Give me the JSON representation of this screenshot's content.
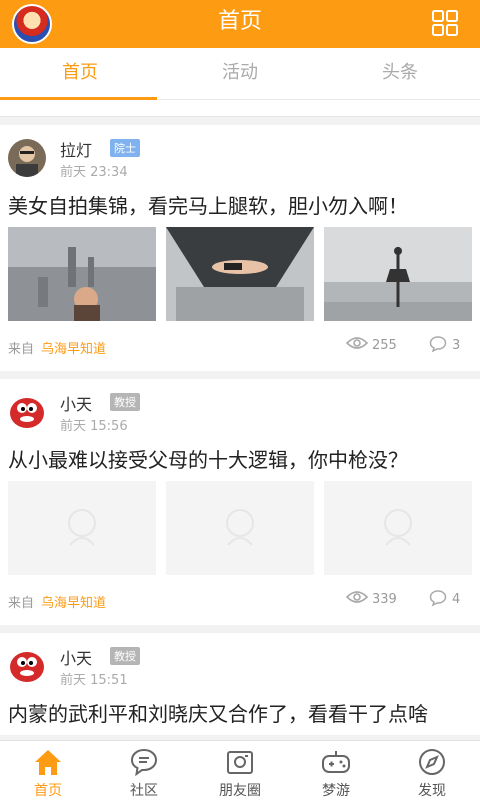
{
  "header": {
    "title": "首页",
    "avatar_icon": "mario-avatar-icon",
    "menu_icon": "grid-icon",
    "brand_color": "#fd9b13"
  },
  "tabs": [
    {
      "label": "首页",
      "active": true
    },
    {
      "label": "活动",
      "active": false
    },
    {
      "label": "头条",
      "active": false
    }
  ],
  "posts": [
    {
      "user": "拉灯",
      "badge": "院士",
      "badge_color": "#7fb2ee",
      "time": "前天 23:34",
      "text": "美女自拍集锦，看完马上腿软，胆小勿入啊！",
      "images": [
        "rooftop-selfie-photo",
        "ledge-pose-photo",
        "ballet-skyline-photo"
      ],
      "source_prefix": "来自",
      "source": "乌海早知道",
      "views": "255",
      "comments": "3"
    },
    {
      "user": "小天",
      "badge": "教授",
      "badge_color": "#b5b5b5",
      "time": "前天 15:56",
      "text": "从小最难以接受父母的十大逻辑，你中枪没？",
      "images": [
        "placeholder-image",
        "placeholder-image",
        "placeholder-image"
      ],
      "source_prefix": "来自",
      "source": "乌海早知道",
      "views": "339",
      "comments": "4"
    },
    {
      "user": "小天",
      "badge": "教授",
      "badge_color": "#b5b5b5",
      "time": "前天 15:51",
      "text": "内蒙的武利平和刘晓庆又合作了，看看干了点啥"
    }
  ],
  "bottom_nav": [
    {
      "label": "首页",
      "icon": "home-icon",
      "active": true
    },
    {
      "label": "社区",
      "icon": "chat-bubble-icon",
      "active": false
    },
    {
      "label": "朋友圈",
      "icon": "camera-icon",
      "active": false
    },
    {
      "label": "梦游",
      "icon": "gamepad-icon",
      "active": false
    },
    {
      "label": "发现",
      "icon": "compass-icon",
      "active": false
    }
  ]
}
